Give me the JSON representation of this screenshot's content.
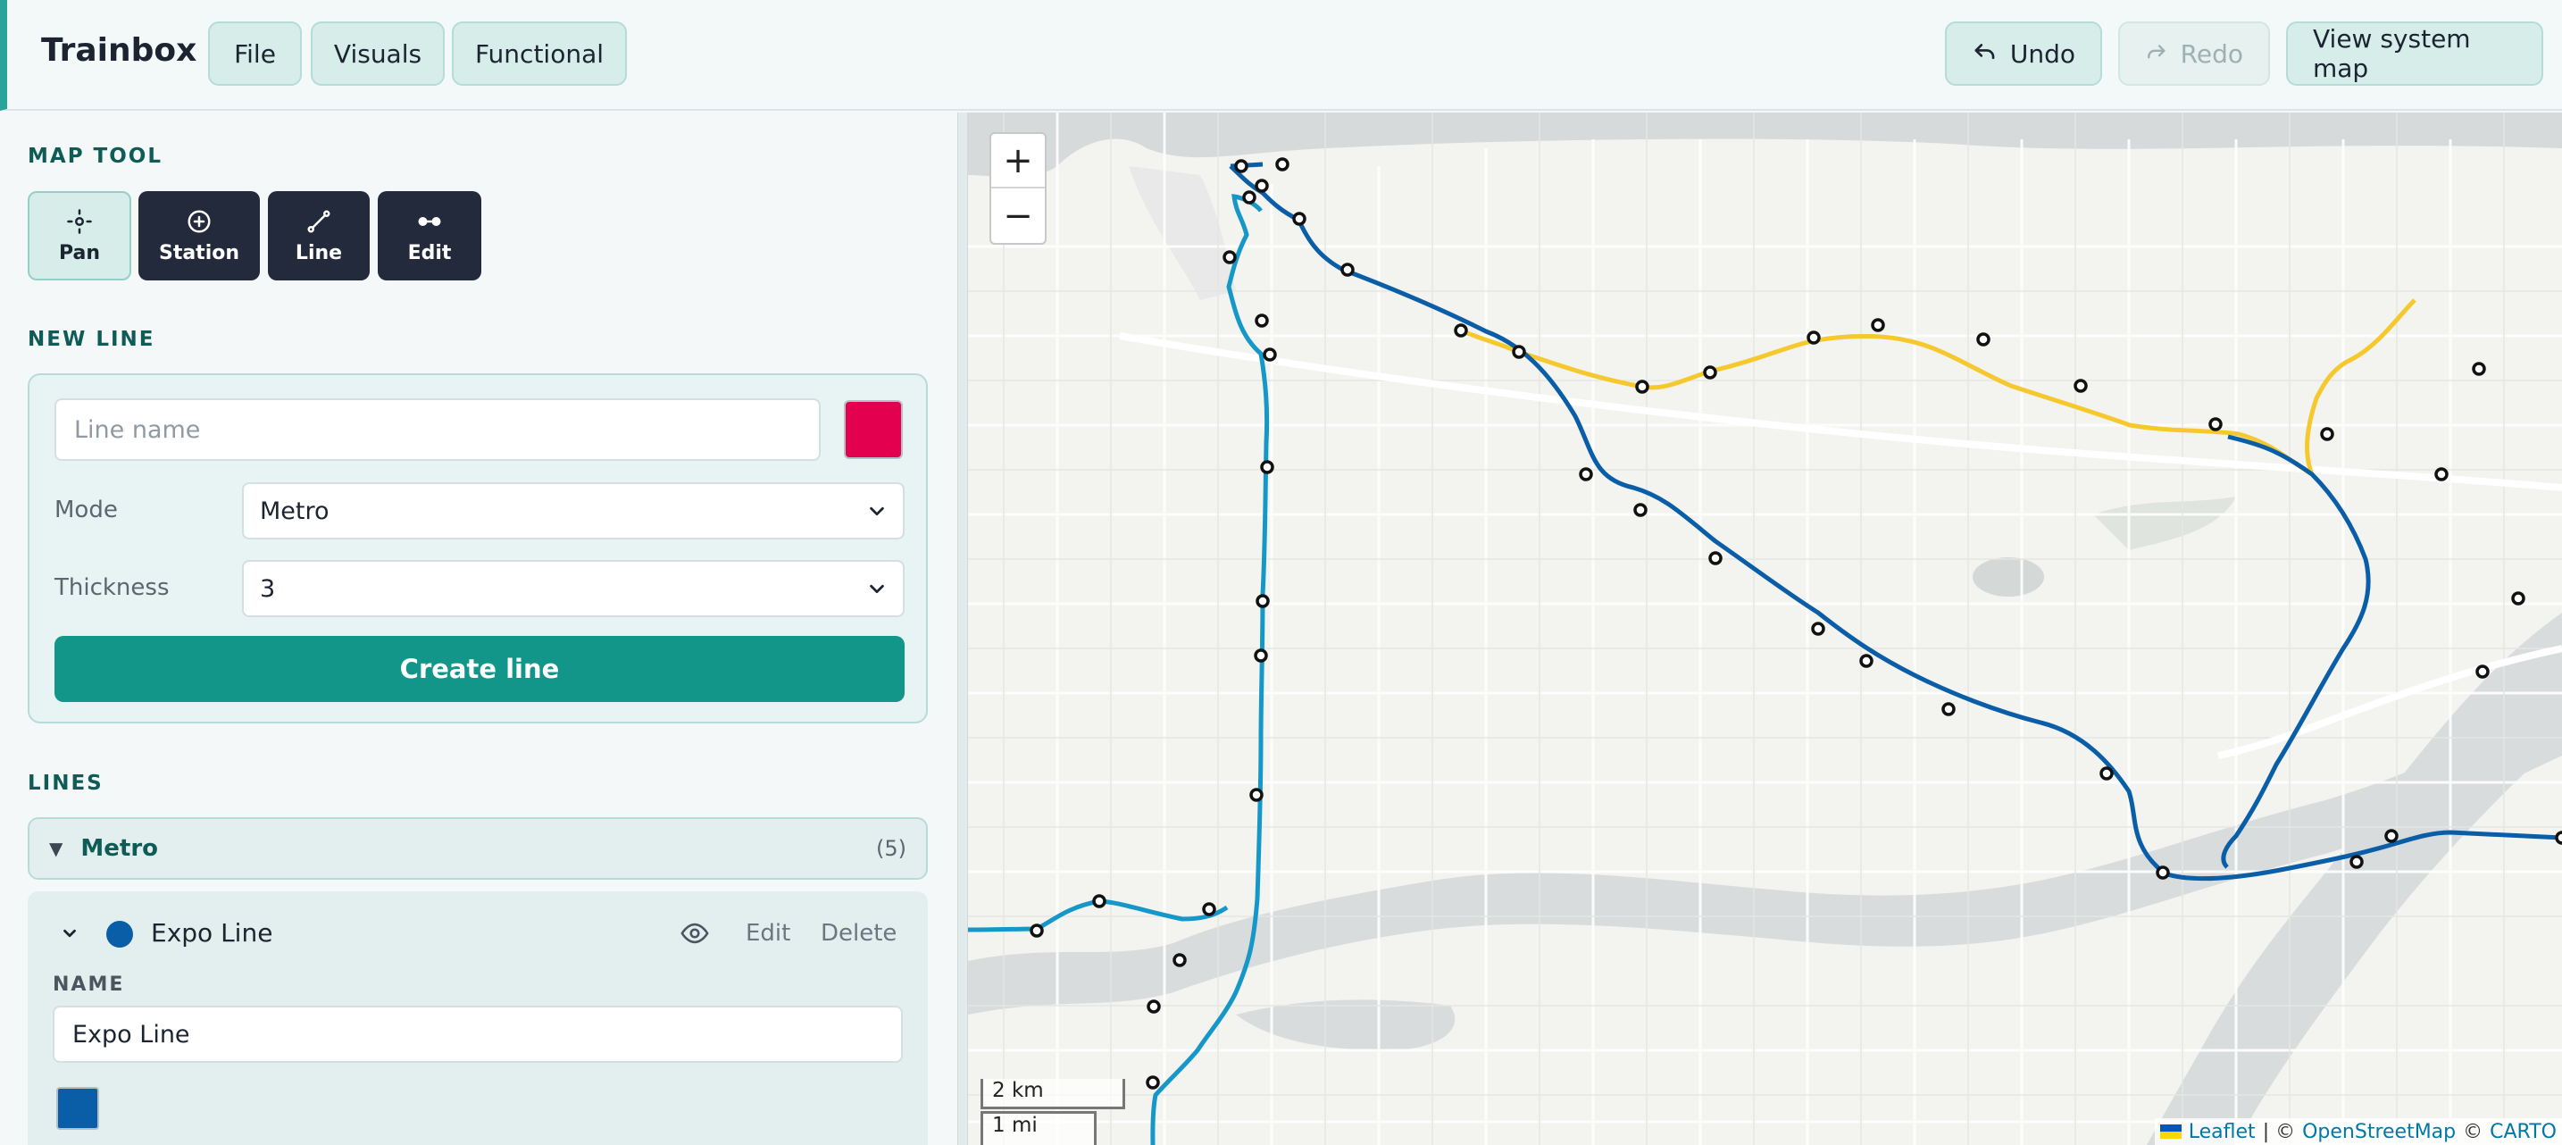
{
  "header": {
    "title": "Trainbox",
    "menu": [
      "File",
      "Visuals",
      "Functional"
    ],
    "undo_label": "Undo",
    "redo_label": "Redo",
    "system_map_label": "View system map"
  },
  "sidebar": {
    "map_tool_title": "MAP TOOL",
    "tools": [
      "Pan",
      "Station",
      "Line",
      "Edit"
    ],
    "active_tool": "Pan",
    "new_line": {
      "title": "NEW LINE",
      "name_placeholder": "Line name",
      "name_value": "",
      "color": "#e2004f",
      "mode_label": "Mode",
      "mode_value": "Metro",
      "thickness_label": "Thickness",
      "thickness_value": "3",
      "create_label": "Create line"
    },
    "lines": {
      "title": "LINES",
      "group_name": "Metro",
      "group_count": "(5)",
      "expanded_line": {
        "name": "Expo Line",
        "color": "#0a5ea8",
        "edit_label": "Edit",
        "delete_label": "Delete",
        "name_field_label": "NAME",
        "name_value": "Expo Line"
      }
    }
  },
  "map": {
    "zoom_in": "+",
    "zoom_out": "−",
    "scale_km": "2 km",
    "scale_mi": "1 mi",
    "attribution": {
      "leaflet": "Leaflet",
      "separator": "| ©",
      "osm": "OpenStreetMap",
      "copyright": "©",
      "carto": "CARTO"
    },
    "line_colors": {
      "expo": "#0a5ea8",
      "canada": "#1597c8",
      "millennium": "#f5c92e"
    }
  }
}
